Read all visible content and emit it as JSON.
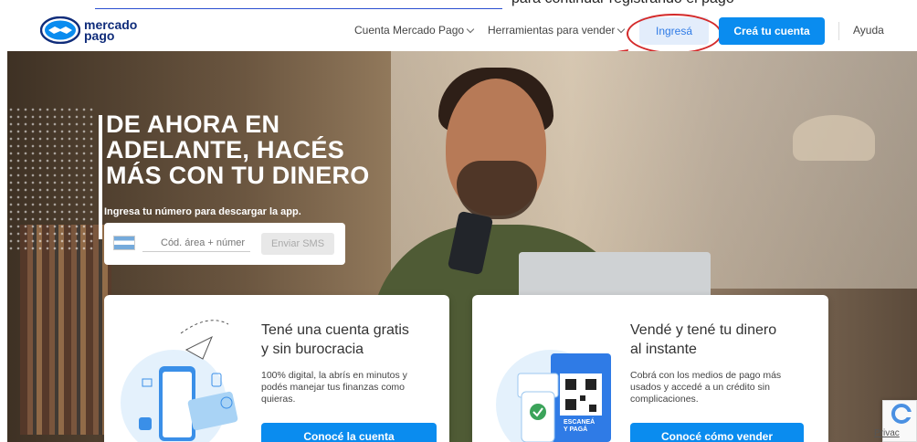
{
  "top_text": {
    "rest": "para continuar registrando el pago"
  },
  "nav": {
    "logo_top": "mercado",
    "logo_bottom": "pago",
    "items": [
      {
        "label": "Cuenta Mercado Pago"
      },
      {
        "label": "Herramientas para vender"
      }
    ],
    "login": "Ingresá",
    "signup": "Creá tu cuenta",
    "help": "Ayuda"
  },
  "hero": {
    "headline_1": "DE AHORA EN",
    "headline_2": "ADELANTE, HACÉS",
    "headline_3": "MÁS CON TU DINERO",
    "subtitle": "Ingresa tu número para descargar la app.",
    "phone_placeholder": "Cód. área + númer",
    "sms_button": "Enviar SMS"
  },
  "cards": [
    {
      "title_1": "Tené una cuenta gratis",
      "title_2": "y sin burocracia",
      "desc_1": "100% digital, la abrís en minutos y",
      "desc_2": "podés manejar tus finanzas como",
      "desc_3": "quieras.",
      "cta": "Conocé la cuenta"
    },
    {
      "title_1": "Vendé y tené tu dinero",
      "title_2": "al instante",
      "desc_1": "Cobrá con los medios de pago más",
      "desc_2": "usados y accedé a un crédito sin",
      "desc_3": "complicaciones.",
      "cta": "Conocé cómo vender",
      "qr_caption_1": "ESCANEÁ",
      "qr_caption_2": "Y PAGÁ"
    }
  ],
  "recaptcha": {
    "label": "Privac"
  },
  "colors": {
    "brand_blue": "#0a8cef",
    "annotation_red": "#d42a2a",
    "logo_navy": "#0f2c7a"
  }
}
